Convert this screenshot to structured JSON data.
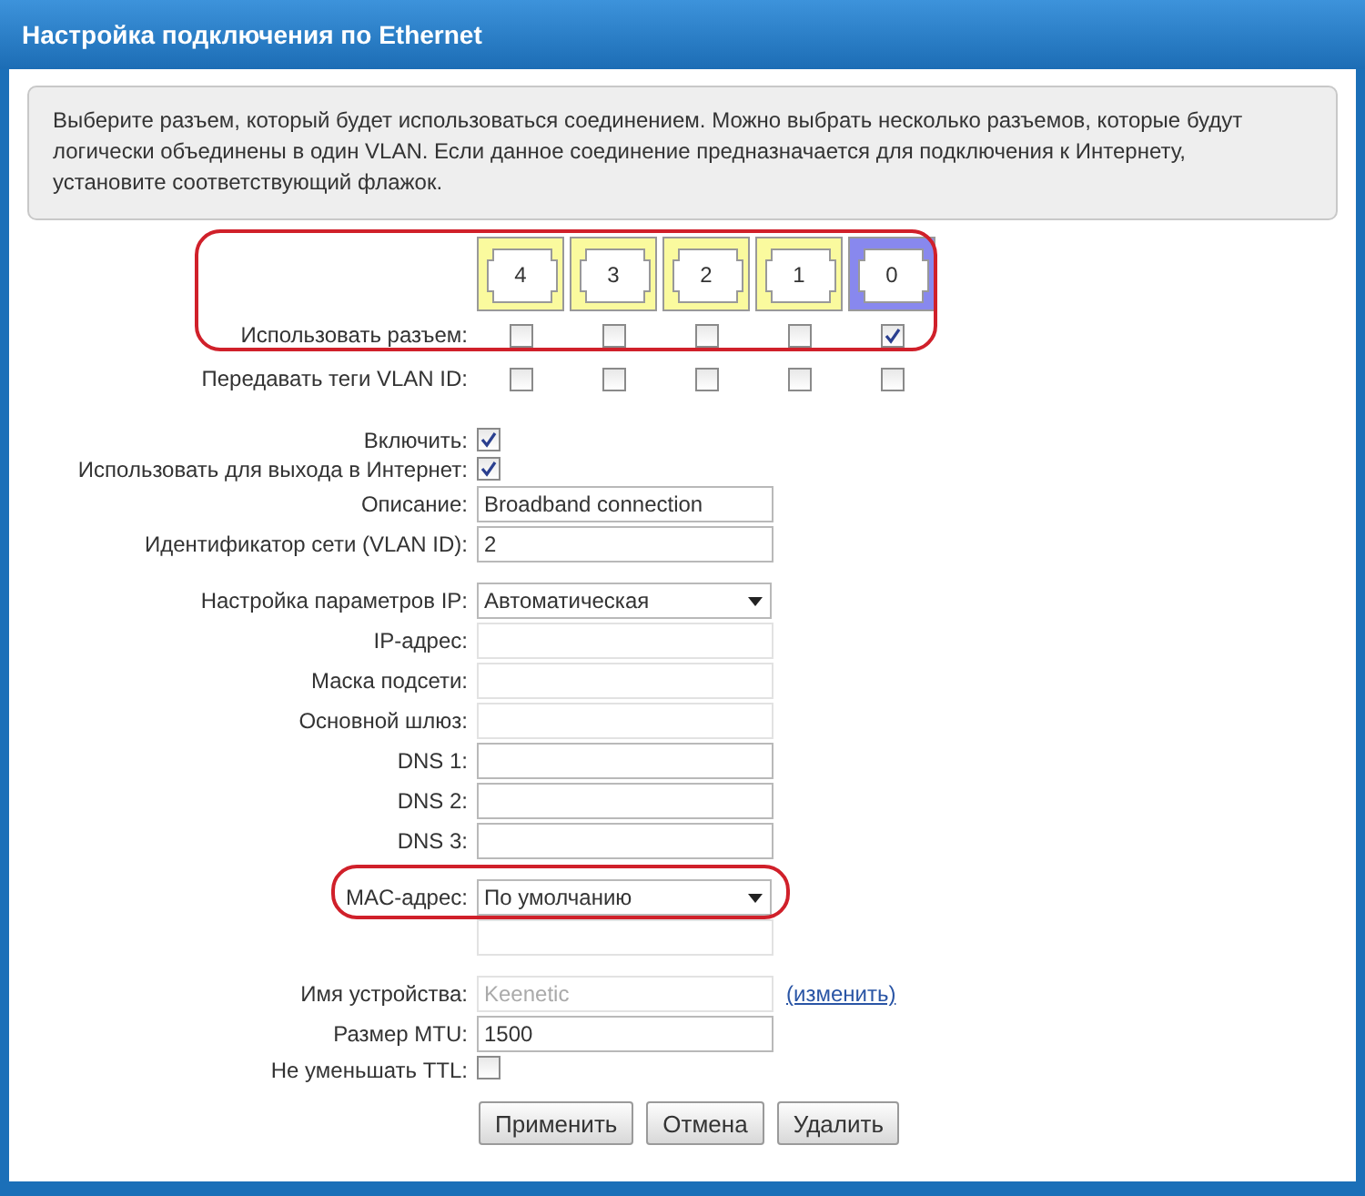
{
  "window": {
    "title": "Настройка подключения по Ethernet"
  },
  "info": "Выберите разъем, который будет использоваться соединением. Можно выбрать несколько разъемов, которые будут логически объединены в один VLAN. Если данное соединение предназначается для подключения к Интернету, установите соответствующий флажок.",
  "ports": {
    "highlighted": true,
    "use_label": "Использовать разъем:",
    "tags_label": "Передавать теги VLAN ID:",
    "items": [
      {
        "label": "4",
        "selected": false,
        "use": false,
        "tags": false
      },
      {
        "label": "3",
        "selected": false,
        "use": false,
        "tags": false
      },
      {
        "label": "2",
        "selected": false,
        "use": false,
        "tags": false
      },
      {
        "label": "1",
        "selected": false,
        "use": false,
        "tags": false
      },
      {
        "label": "0",
        "selected": true,
        "use": true,
        "tags": false
      }
    ]
  },
  "groups": [
    [
      {
        "kind": "checkbox",
        "label": "Включить:",
        "checked": true
      },
      {
        "kind": "checkbox",
        "label": "Использовать для выхода в Интернет:",
        "checked": true
      },
      {
        "kind": "text",
        "label": "Описание:",
        "value": "Broadband connection",
        "disabled": false
      },
      {
        "kind": "text",
        "label": "Идентификатор сети (VLAN ID):",
        "value": "2",
        "disabled": false
      }
    ],
    [
      {
        "kind": "select",
        "label": "Настройка параметров IP:",
        "value": "Автоматическая"
      },
      {
        "kind": "text",
        "label": "IP-адрес:",
        "disabled": true
      },
      {
        "kind": "text",
        "label": "Маска подсети:",
        "disabled": true
      },
      {
        "kind": "text",
        "label": "Основной шлюз:",
        "disabled": true
      },
      {
        "kind": "text",
        "label": "DNS 1:",
        "disabled": false
      },
      {
        "kind": "text",
        "label": "DNS 2:",
        "disabled": false
      },
      {
        "kind": "text",
        "label": "DNS 3:",
        "disabled": false
      }
    ],
    [
      {
        "kind": "select",
        "label": "MAC-адрес:",
        "value": "По умолчанию",
        "highlighted": true
      },
      {
        "kind": "text",
        "disabled": true
      }
    ],
    [
      {
        "kind": "text",
        "label": "Имя устройства:",
        "value": "Keenetic",
        "disabled": true,
        "link": "(изменить)"
      },
      {
        "kind": "text",
        "label": "Размер MTU:",
        "value": "1500",
        "disabled": false
      },
      {
        "kind": "checkbox",
        "label": "Не уменьшать TTL:",
        "checked": false
      }
    ]
  ],
  "buttons": [
    "Применить",
    "Отмена",
    "Удалить"
  ]
}
